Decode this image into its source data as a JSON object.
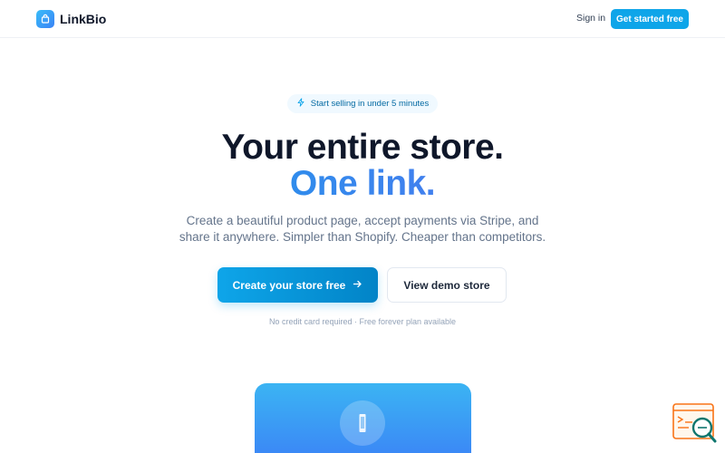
{
  "header": {
    "brand": "LinkBio",
    "brand_icon": "shopping-bag-icon",
    "signin_label": "Sign in",
    "cta_label": "Get started free"
  },
  "hero": {
    "badge_icon": "lightning-icon",
    "badge_text": "Start selling in under 5 minutes",
    "headline_line1": "Your entire store.",
    "headline_line2": "One link.",
    "subtitle_line1": "Create a beautiful product page, accept payments via Stripe, and",
    "subtitle_line2": "share it anywhere. Simpler than Shopify. Cheaper than competitors.",
    "primary_button_label": "Create your store free",
    "primary_button_icon": "arrow-right-icon",
    "secondary_button_label": "View demo store",
    "note": "No credit card required · Free forever plan available"
  },
  "preview": {
    "avatar_icon": "phone-icon"
  },
  "widget": {
    "icon": "code-search-icon"
  },
  "colors": {
    "accent": "#0ea5e9",
    "gradient_end": "#6366f1",
    "text_dark": "#0f172a",
    "text_muted": "#64748b"
  }
}
